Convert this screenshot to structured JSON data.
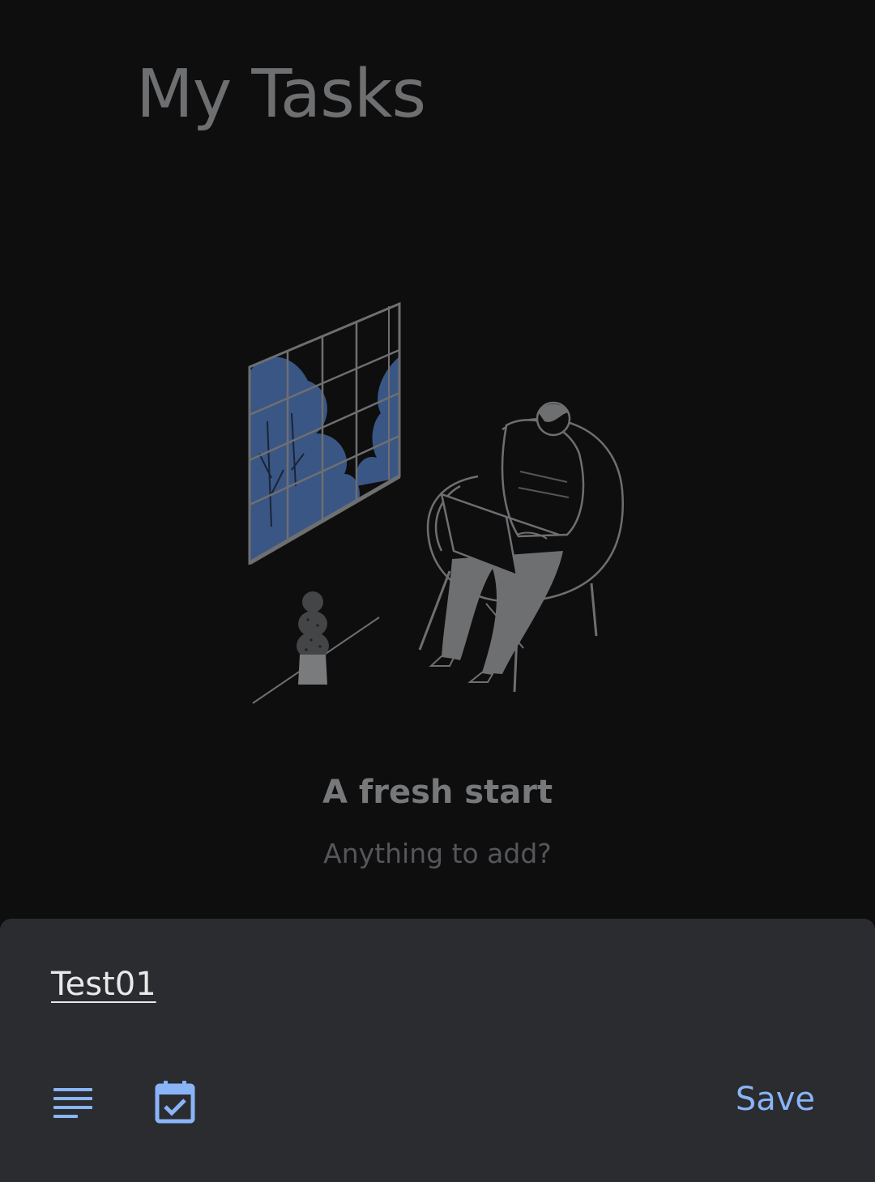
{
  "header": {
    "title": "My Tasks"
  },
  "empty_state": {
    "illustration_icon": "person-reading-by-window-illustration",
    "title": "A fresh start",
    "subtitle": "Anything to add?"
  },
  "new_task_sheet": {
    "input_value": "Test01",
    "details_icon": "notes-lines-icon",
    "date_icon": "calendar-check-icon",
    "save_label": "Save"
  },
  "colors": {
    "accent": "#8ab4f8",
    "background": "#0e0e0f",
    "sheet_background": "#2b2c2f",
    "window_fill": "#3a5684"
  }
}
